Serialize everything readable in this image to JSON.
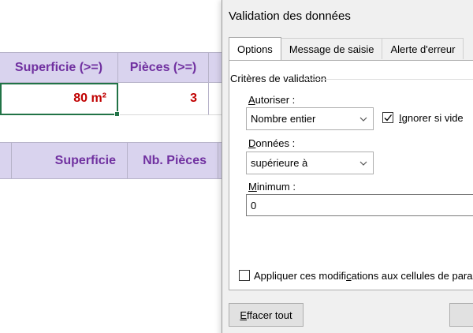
{
  "sheet": {
    "header_row_1": [
      "Superficie (>=)",
      "Pièces (>=)",
      ""
    ],
    "value_row": [
      "80 m²",
      "3",
      ""
    ],
    "header_row_2": [
      "",
      "Superficie",
      "Nb. Pièces",
      ""
    ]
  },
  "dialog": {
    "title": "Validation des données",
    "tabs": [
      "Options",
      "Message de saisie",
      "Alerte d'erreur"
    ],
    "active_tab": "Options",
    "group_title": "Critères de validation",
    "allow_label_u": "A",
    "allow_label_rest": "utoriser :",
    "allow_value": "Nombre entier",
    "ignore_blank_u": "I",
    "ignore_blank_rest": "gnorer si vide",
    "ignore_blank_checked": true,
    "data_label_u": "D",
    "data_label_rest": "onnées :",
    "data_value": "supérieure à",
    "minimum_label_u": "M",
    "minimum_label_rest": "inimum :",
    "minimum_value": "0",
    "apply_all_pre": "Appliquer ces modifi",
    "apply_all_u": "c",
    "apply_all_post": "ations aux cellules de param",
    "apply_all_checked": false,
    "clear_all_u": "E",
    "clear_all_rest": "ffacer tout"
  },
  "colors": {
    "header_fill": "#d9d3ee",
    "header_text": "#7030a0",
    "value_text": "#c00000",
    "selection": "#217346"
  }
}
